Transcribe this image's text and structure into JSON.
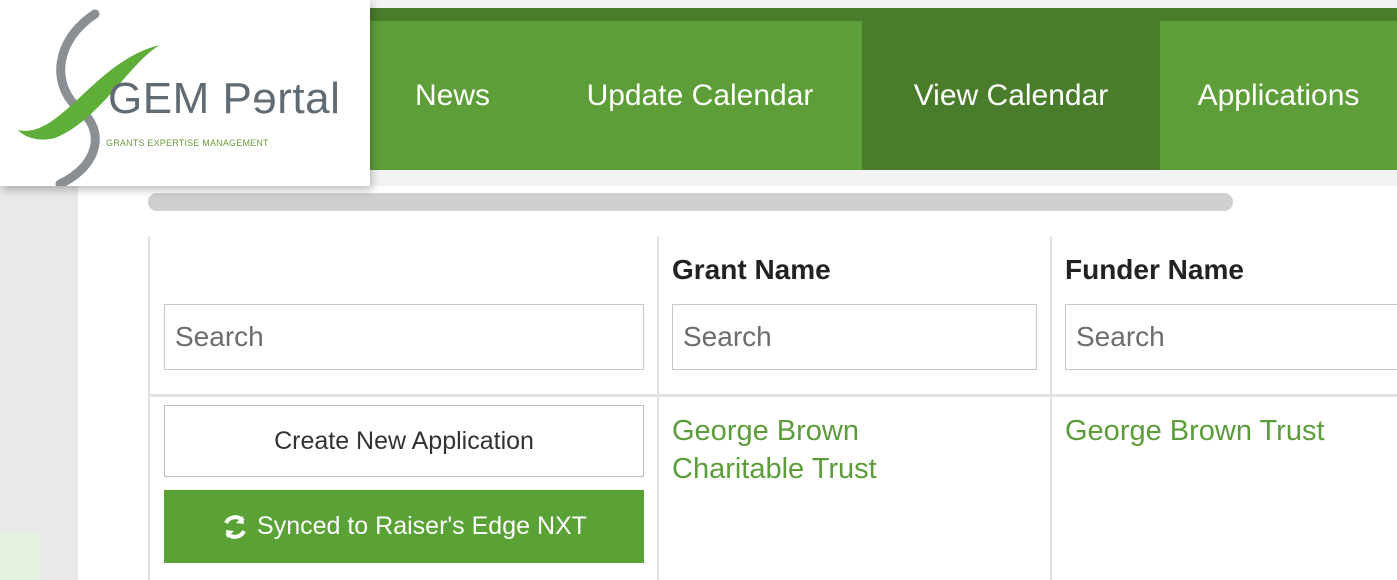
{
  "logo": {
    "title": "GEM Pɘrtal",
    "subtitle": "GRANTS EXPERTISE MANAGEMENT"
  },
  "nav": {
    "items": [
      {
        "label": "News",
        "active": false
      },
      {
        "label": "Update Calendar",
        "active": false
      },
      {
        "label": "View Calendar",
        "active": true
      },
      {
        "label": "Applications",
        "active": false
      }
    ]
  },
  "colors": {
    "nav_green": "#5e9e38",
    "nav_active": "#4a7d2b",
    "link_green": "#5c9c3b",
    "button_green": "#5aa136"
  },
  "table": {
    "columns": [
      {
        "header": "",
        "search_placeholder": "Search"
      },
      {
        "header": "Grant Name",
        "search_placeholder": "Search"
      },
      {
        "header": "Funder Name",
        "search_placeholder": "Search"
      }
    ],
    "row": {
      "create_label": "Create New Application",
      "sync_label": "Synced to Raiser's Edge NXT",
      "sync_icon": "sync-icon",
      "grant_name_line1": "George Brown",
      "grant_name_line2": "Charitable Trust",
      "funder_name": "George Brown Trust"
    }
  }
}
